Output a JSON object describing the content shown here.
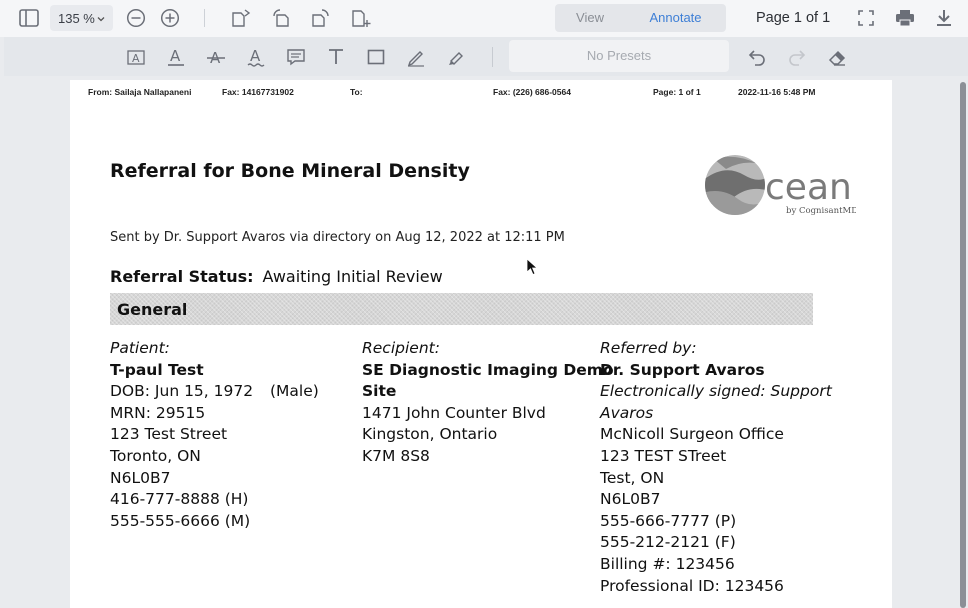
{
  "toolbar": {
    "zoom_value": "135 %",
    "mode_view": "View",
    "mode_annotate": "Annotate",
    "page_indicator": "Page 1 of 1"
  },
  "annotation_toolbar": {
    "presets_placeholder": "No Presets"
  },
  "fax_header": {
    "from": "From: Sailaja Nallapaneni",
    "fax_from": "Fax: 14167731902",
    "to": "To:",
    "fax_to": "Fax: (226) 686-0564",
    "page": "Page: 1 of 1",
    "datetime": "2022-11-16 5:48 PM"
  },
  "document": {
    "title": "Referral for Bone Mineral Density",
    "logo_wordmark": "cean",
    "logo_byline": "by CognisantMD",
    "sent_by": "Sent by Dr. Support Avaros via directory on Aug 12, 2022 at 12:11 PM",
    "status_label": "Referral Status:",
    "status_value": "Awaiting Initial Review",
    "section_heading": "General",
    "patient": {
      "heading": "Patient:",
      "name": "T-paul Test",
      "dob": "DOB: Jun 15, 1972",
      "sex": "(Male)",
      "mrn": "MRN: 29515",
      "street": "123 Test Street",
      "city": "Toronto, ON",
      "postal": "N6L0B7",
      "phone_home": "416-777-8888 (H)",
      "phone_mobile": "555-555-6666 (M)"
    },
    "recipient": {
      "heading": "Recipient:",
      "name_line1": "SE Diagnostic Imaging Demo",
      "name_line2": "Site",
      "street": "1471 John Counter Blvd",
      "city": "Kingston, Ontario",
      "postal": "K7M 8S8"
    },
    "referrer": {
      "heading": "Referred by:",
      "name": "Dr. Support Avaros",
      "signed_line1": "Electronically signed: Support",
      "signed_line2": "Avaros",
      "office": "McNicoll Surgeon Office",
      "street": "123 TEST STreet",
      "city": "Test, ON",
      "postal": "N6L0B7",
      "phone": "555-666-7777 (P)",
      "fax": "555-212-2121 (F)",
      "billing": "Billing #: 123456",
      "professional_id": "Professional ID: 123456"
    }
  },
  "icons": {
    "sidebar": "sidebar-toggle-icon",
    "zoom_out": "zoom-out-icon",
    "zoom_in": "zoom-in-icon",
    "rotate": [
      "insert-page-icon",
      "rotate-left-icon",
      "rotate-right-icon",
      "add-page-icon"
    ],
    "fullscreen": "fullscreen-icon",
    "print": "print-icon",
    "download": "download-icon"
  },
  "colors": {
    "accent": "#3e7fd6",
    "toolbar_bg": "#f5f6f8",
    "annotation_bar_bg": "#e4e7eb"
  }
}
